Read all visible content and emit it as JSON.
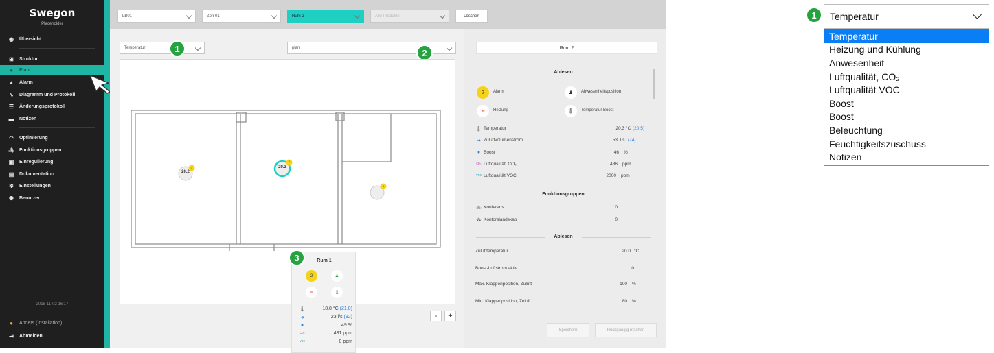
{
  "brand": {
    "name": "Swegon",
    "subtitle": "Placeholder"
  },
  "sidebar": {
    "items": [
      {
        "label": "Übersicht",
        "icon": "eye-icon"
      },
      {
        "label": "Struktur",
        "icon": "structure-icon"
      },
      {
        "label": "Plan",
        "icon": "pin-icon"
      },
      {
        "label": "Alarm",
        "icon": "bell-icon"
      },
      {
        "label": "Diagramm und Protokoll",
        "icon": "chart-icon"
      },
      {
        "label": "Änderungsprotokoll",
        "icon": "list-icon"
      },
      {
        "label": "Notizen",
        "icon": "note-icon"
      },
      {
        "label": "Optimierung",
        "icon": "gauge-icon"
      },
      {
        "label": "Funktionsgruppen",
        "icon": "group-icon"
      },
      {
        "label": "Einregulierung",
        "icon": "regulate-icon"
      },
      {
        "label": "Dokumentation",
        "icon": "document-icon"
      },
      {
        "label": "Einstellungen",
        "icon": "gear-icon"
      },
      {
        "label": "Benutzer",
        "icon": "users-icon"
      }
    ],
    "timestamp": "2018-11-02 16:17",
    "user": "Anders (Installation)",
    "logout": "Abmelden"
  },
  "topbar": {
    "select1": "LB01",
    "select2": "Zon 01",
    "select3": "Rum 2",
    "select4": "Alle Produkte",
    "clear": "Löschen"
  },
  "toolbar": {
    "view_select": "Temperatur",
    "plan_select": "plan"
  },
  "markers": {
    "one": "1",
    "two": "2",
    "three": "3"
  },
  "map": {
    "rooms": [
      {
        "value": "20.2",
        "alarms": "1"
      },
      {
        "value": "20.3",
        "alarms": "2"
      },
      {
        "value": "",
        "alarms": "1"
      }
    ],
    "zoom_out": "-",
    "zoom_in": "+"
  },
  "popup": {
    "title": "Rum 1",
    "alarm_count": "2",
    "rows": [
      {
        "value": "18.8 °C",
        "setpoint": "(21.0)"
      },
      {
        "value": "23 l/s",
        "setpoint": "(82)"
      },
      {
        "value": "49 %",
        "setpoint": ""
      },
      {
        "value": "431 ppm",
        "setpoint": ""
      },
      {
        "value": "0 ppm",
        "setpoint": ""
      }
    ]
  },
  "panel": {
    "title": "Rum 2",
    "section_ablesen": "Ablesen",
    "status": {
      "alarm_count": "2",
      "alarm_label": "Alarm",
      "presence_label": "Abwesenheitsposition",
      "heating_label": "Heizung",
      "boost_label": "Temperatur Boost"
    },
    "readings": [
      {
        "label": "Temperatur",
        "value": "20.3",
        "unit": "°C",
        "setpoint": "(20.5)"
      },
      {
        "label": "Zuluftvolumenstrom",
        "value": "53",
        "unit": "l/s",
        "setpoint": "(74)"
      },
      {
        "label": "Boost",
        "value": "46",
        "unit": "%",
        "setpoint": ""
      },
      {
        "label": "Luftqualität, CO₂",
        "value": "436",
        "unit": "ppm",
        "setpoint": ""
      },
      {
        "label": "Luftqualität VOC",
        "value": "2000",
        "unit": "ppm",
        "setpoint": ""
      }
    ],
    "section_funktionsgruppen": "Funktionsgruppen",
    "groups": [
      {
        "label": "Konferens",
        "value": "0"
      },
      {
        "label": "Kontorslandskap",
        "value": "0"
      }
    ],
    "section_ablesen2": "Ablesen",
    "settings": [
      {
        "label": "Zulufttemperatur",
        "value": "20.0",
        "unit": "°C"
      },
      {
        "label": "Boost-Luftstrom aktiv",
        "value": "0",
        "unit": ""
      },
      {
        "label": "Max. Klappenposition, Zuluft",
        "value": "100",
        "unit": "%"
      },
      {
        "label": "Min. Klappenposition, Zuluft",
        "value": "80",
        "unit": "%"
      }
    ],
    "save": "Speichern",
    "undo": "Rückgängig machen"
  },
  "dropdown": {
    "marker": "1",
    "selected": "Temperatur",
    "options": [
      "Temperatur",
      "Heizung und Kühlung",
      "Anwesenheit",
      "Luftqualität, CO₂",
      "Luftqualität VOC",
      "Boost",
      "Boost",
      "Beleuchtung",
      "Feuchtigkeitszuschuss",
      "Notizen"
    ]
  },
  "colors": {
    "accent": "#1fb5a4",
    "sidebar": "#1f1f1f",
    "marker": "#24a33f",
    "alarm": "#f5d31a",
    "selected_option": "#0a7ff5"
  }
}
